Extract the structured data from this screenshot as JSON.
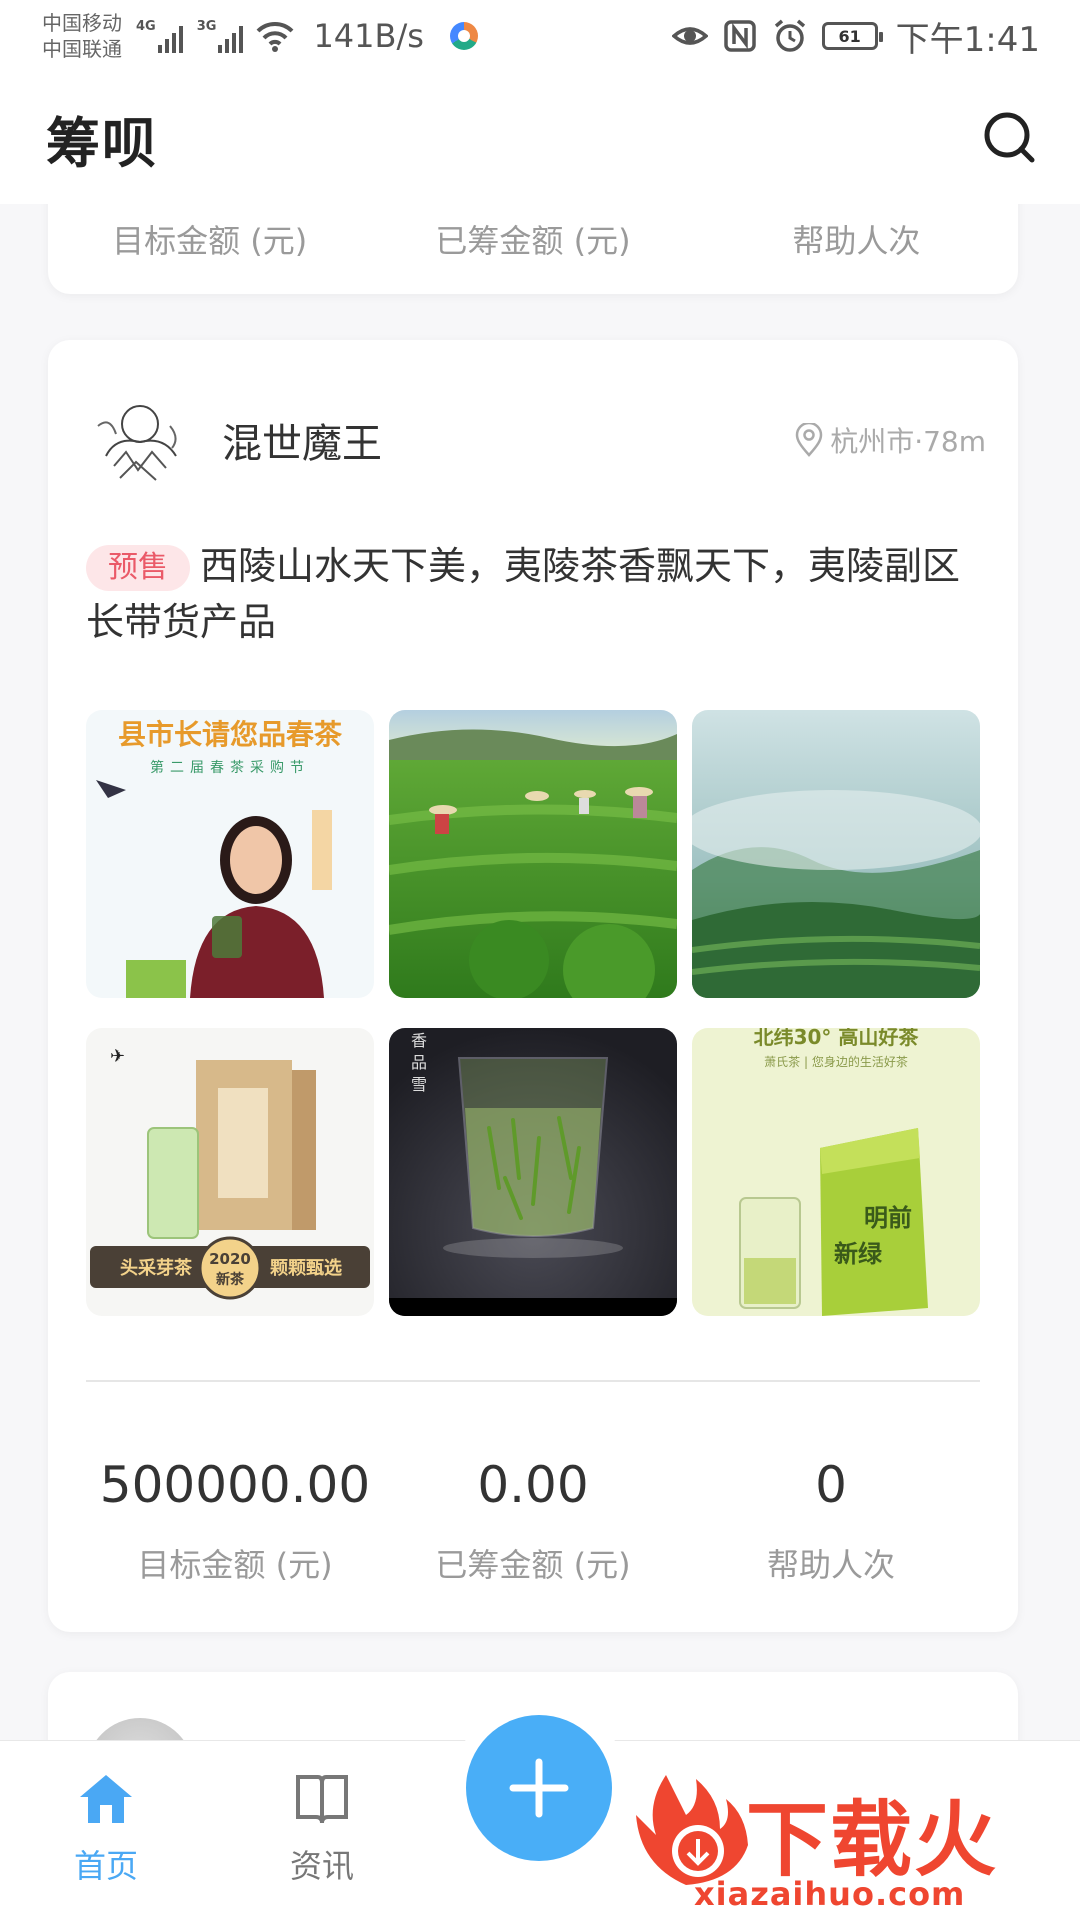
{
  "status_bar": {
    "carrier1": "中国移动",
    "carrier2": "中国联通",
    "net1": "4G",
    "net2": "3G",
    "speed": "141B/s",
    "battery": "61",
    "time": "下午1:41"
  },
  "header": {
    "title": "筹呗",
    "search_icon": "search-icon"
  },
  "prev_card": {
    "labels": [
      "目标金额 (元)",
      "已筹金额 (元)",
      "帮助人次"
    ]
  },
  "post": {
    "author": "混世魔王",
    "location": "杭州市·78m",
    "tag": "预售",
    "text": "西陵山水天下美，夷陵茶香飘天下，夷陵副区长带货产品",
    "images": [
      {
        "name": "poster-spring-tea",
        "texts": [
          "县市长请您品春茶",
          "第二届春茶采购节"
        ]
      },
      {
        "name": "tea-field-pickers"
      },
      {
        "name": "misty-mountain-tea"
      },
      {
        "name": "boxed-tea-product",
        "texts": [
          "头采芽茶",
          "2020",
          "新茶",
          "颗颗甄选"
        ]
      },
      {
        "name": "tea-glass-dark",
        "texts": [
          "香",
          "品",
          "雪"
        ]
      },
      {
        "name": "green-tea-bag",
        "texts": [
          "北纬30° 高山好茶",
          "萧氏茶 | 您身边的生活好茶",
          "明前",
          "新绿"
        ]
      }
    ],
    "stats": [
      {
        "value": "500000.00",
        "label": "目标金额 (元)"
      },
      {
        "value": "0.00",
        "label": "已筹金额 (元)"
      },
      {
        "value": "0",
        "label": "帮助人次"
      }
    ]
  },
  "bottom_nav": {
    "home": "首页",
    "news": "资讯",
    "add_icon": "plus-icon"
  },
  "watermark": {
    "text": "下载火",
    "url": "xiazaihuo.com"
  },
  "colors": {
    "accent": "#49aef7",
    "tag_bg": "#fde6e8",
    "tag_text": "#ea5a68",
    "watermark": "#ef4630"
  }
}
